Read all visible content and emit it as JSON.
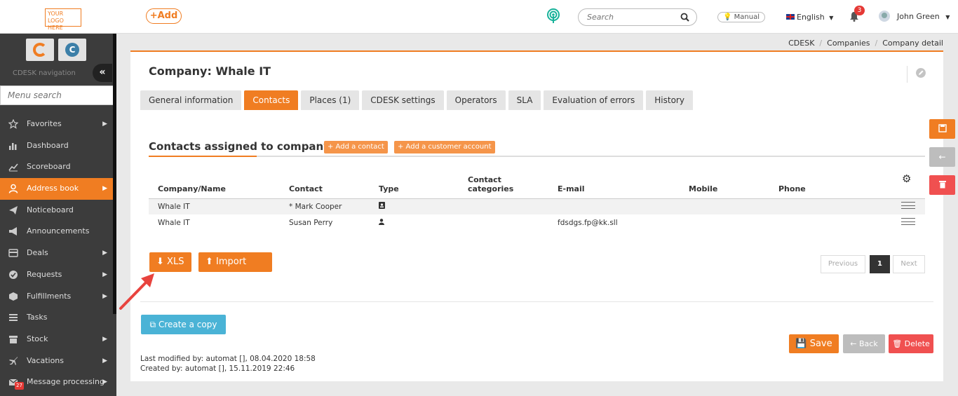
{
  "topbar": {
    "logo_line1": "YOUR LOGO",
    "logo_line2": "HERE",
    "add_label": "+Add",
    "search_placeholder": "Search",
    "manual_label": "Manual",
    "language": "English",
    "notification_count": "3",
    "user_name": "John Green"
  },
  "sidebar": {
    "nav_label": "CDESK navigation",
    "menu_search_placeholder": "Menu search",
    "items": [
      {
        "label": "Favorites",
        "arrow": true
      },
      {
        "label": "Dashboard",
        "arrow": false
      },
      {
        "label": "Scoreboard",
        "arrow": false
      },
      {
        "label": "Address book",
        "arrow": true,
        "active": true
      },
      {
        "label": "Noticeboard",
        "arrow": false
      },
      {
        "label": "Announcements",
        "arrow": false
      },
      {
        "label": "Deals",
        "arrow": true
      },
      {
        "label": "Requests",
        "arrow": true
      },
      {
        "label": "Fulfillments",
        "arrow": true
      },
      {
        "label": "Tasks",
        "arrow": false
      },
      {
        "label": "Stock",
        "arrow": true
      },
      {
        "label": "Vacations",
        "arrow": true
      },
      {
        "label": "Message processing",
        "arrow": true
      }
    ],
    "message_badge": "27"
  },
  "breadcrumb": [
    "CDESK",
    "Companies",
    "Company detail"
  ],
  "page": {
    "title": "Company: Whale IT",
    "tabs": [
      "General information",
      "Contacts",
      "Places (1)",
      "CDESK settings",
      "Operators",
      "SLA",
      "Evaluation of errors",
      "History"
    ],
    "active_tab": "Contacts",
    "section_title": "Contacts assigned to company",
    "add_contact_label": "+ Add a contact",
    "add_account_label": "+ Add a customer account"
  },
  "table": {
    "headers": [
      "Company/Name",
      "Contact",
      "Type",
      "Contact\ncategories",
      "E-mail",
      "Mobile",
      "Phone"
    ],
    "rows": [
      {
        "company": "Whale IT",
        "contact": "* Mark Cooper",
        "email": ""
      },
      {
        "company": "Whale IT",
        "contact": "Susan Perry",
        "email": "fdsdgs.fp@kk.sll"
      }
    ]
  },
  "buttons": {
    "xls": "XLS",
    "import_xls": "Import XLS",
    "previous": "Previous",
    "page": "1",
    "next": "Next",
    "create_copy": "Create a copy",
    "save": "Save",
    "back": "Back",
    "delete": "Delete"
  },
  "meta": {
    "last_modified": "Last modified by: automat  [], 08.04.2020 18:58",
    "created_by": "Created by: automat  [], 15.11.2019 22:46"
  },
  "colors": {
    "accent": "#f07d22",
    "sidebar": "#3c3c3c",
    "copy": "#4ab3d6",
    "delete": "#f05050",
    "back": "#bdbdbd"
  }
}
